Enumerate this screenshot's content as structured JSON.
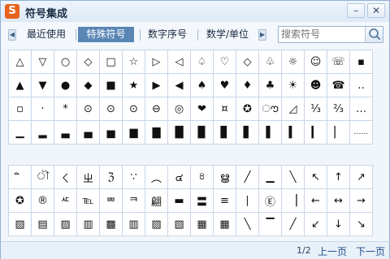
{
  "window": {
    "app_icon": "S",
    "title": "符号集成",
    "minimize_glyph": "–",
    "close_glyph": "✕"
  },
  "categories": {
    "prev_arrow": "◀",
    "next_arrow": "▶",
    "tabs": [
      {
        "label": "最近使用",
        "active": false
      },
      {
        "label": "特殊符号",
        "active": true
      },
      {
        "label": "数字序号",
        "active": false
      },
      {
        "label": "数学/单位",
        "active": false
      }
    ]
  },
  "search": {
    "placeholder": "搜索符号",
    "icon": "search-icon"
  },
  "symbols_top": [
    [
      "△",
      "▽",
      "○",
      "◇",
      "□",
      "☆",
      "▷",
      "◁",
      "♤",
      "♡",
      "◇",
      "♧",
      "☼",
      "☺",
      "☏",
      "▪"
    ],
    [
      "▲",
      "▼",
      "●",
      "◆",
      "■",
      "★",
      "▶",
      "◀",
      "♠",
      "♥",
      "♦",
      "♣",
      "☀",
      "☻",
      "☎",
      "‥"
    ],
    [
      "▫",
      "·",
      "*",
      "⊙",
      "⊙",
      "⊙",
      "⊖",
      "◎",
      "❤",
      "¤",
      "✪",
      "ൗ",
      "◿",
      "⅓",
      "⅔",
      "…"
    ],
    [
      "▁",
      "▂",
      "▃",
      "▄",
      "▅",
      "▆",
      "▇",
      "█",
      "▉",
      "▊",
      "▋",
      "▌",
      "▍",
      "▎",
      "▏",
      "……"
    ]
  ],
  "symbols_bottom": [
    [
      "ิ",
      "ৗ",
      "ㄑ",
      "ㄓ",
      "ℨ",
      "∵",
      "︵",
      "๔",
      "৪",
      "ൠ",
      "╱",
      "▁",
      "╲",
      "↖",
      "↑",
      "↗"
    ],
    [
      "✪",
      "®",
      "ᄯ",
      "℡",
      "ᄈ",
      "ᄏ",
      "翩",
      "▬",
      "〓",
      "≡",
      "∣",
      "Ⓔ",
      "▕",
      "←",
      "↔",
      "→"
    ],
    [
      "▧",
      "▤",
      "▨",
      "▥",
      "▩",
      "▥",
      "▨",
      "▧",
      "▦",
      "▦",
      "╲",
      "▔",
      "╱",
      "↙",
      "↓",
      "↘"
    ]
  ],
  "footer": {
    "page_indicator": "1/2",
    "prev_label": "上一页",
    "next_label": "下一页"
  }
}
